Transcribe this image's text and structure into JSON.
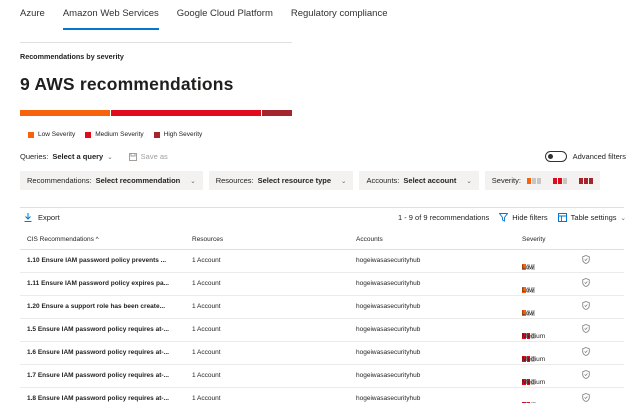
{
  "tabs": [
    "Azure",
    "Amazon Web Services",
    "Google Cloud Platform",
    "Regulatory compliance"
  ],
  "active_tab": 1,
  "section_title": "Recommendations by severity",
  "big_title": "9 AWS recommendations",
  "severity_distribution": {
    "low": 3,
    "medium": 5,
    "high": 1
  },
  "colors": {
    "low": "#f7630c",
    "medium": "#e00b1c",
    "high": "#a4262c",
    "inactive": "#c8c6c4",
    "accent": "#0078d4"
  },
  "legend": [
    "Low Severity",
    "Medium Severity",
    "High Severity"
  ],
  "queries": {
    "label": "Queries:",
    "value": "Select a query",
    "save_as": "Save as"
  },
  "advanced_filters": "Advanced filters",
  "filters": [
    {
      "label": "Recommendations:",
      "value": "Select recommendation"
    },
    {
      "label": "Resources:",
      "value": "Select resource type"
    },
    {
      "label": "Accounts:",
      "value": "Select account"
    }
  ],
  "severity_filter_label": "Severity:",
  "toolbar": {
    "export": "Export",
    "count": "1 - 9 of 9 recommendations",
    "hide_filters": "Hide filters",
    "table_settings": "Table settings"
  },
  "columns": [
    "CIS Recommendations ^",
    "Resources",
    "Accounts",
    "Severity"
  ],
  "rows": [
    {
      "name": "1.10 Ensure IAM password policy prevents ...",
      "resources": "1 Account",
      "account": "hogeiwasasecurityhub",
      "severity": "Low"
    },
    {
      "name": "1.11 Ensure IAM password policy expires pa...",
      "resources": "1 Account",
      "account": "hogeiwasasecurityhub",
      "severity": "Low"
    },
    {
      "name": "1.20 Ensure a support role has been create...",
      "resources": "1 Account",
      "account": "hogeiwasasecurityhub",
      "severity": "Low"
    },
    {
      "name": "1.5 Ensure IAM password policy requires at-...",
      "resources": "1 Account",
      "account": "hogeiwasasecurityhub",
      "severity": "Medium"
    },
    {
      "name": "1.6 Ensure IAM password policy requires at-...",
      "resources": "1 Account",
      "account": "hogeiwasasecurityhub",
      "severity": "Medium"
    },
    {
      "name": "1.7 Ensure IAM password policy requires at-...",
      "resources": "1 Account",
      "account": "hogeiwasasecurityhub",
      "severity": "Medium"
    },
    {
      "name": "1.8 Ensure IAM password policy requires at-...",
      "resources": "1 Account",
      "account": "hogeiwasasecurityhub",
      "severity": "Medium"
    }
  ]
}
